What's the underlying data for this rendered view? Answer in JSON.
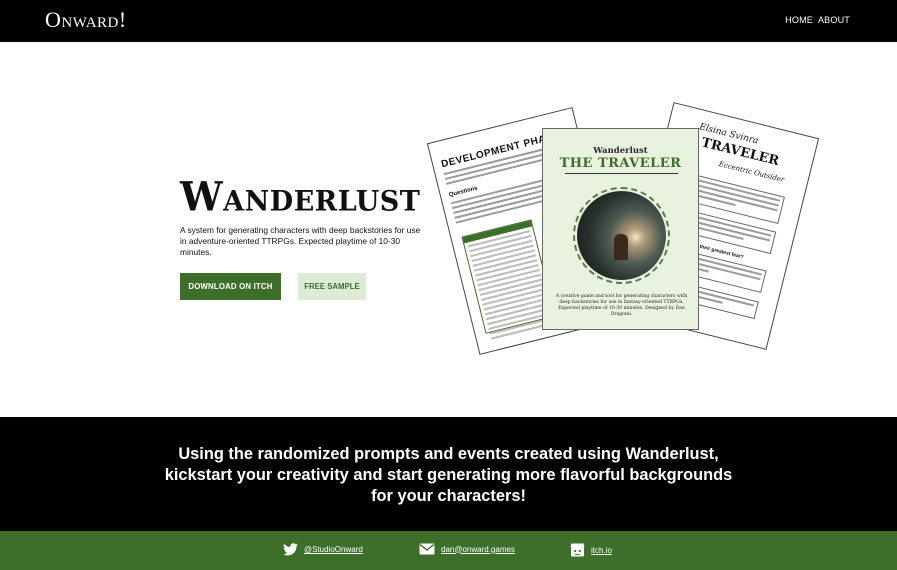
{
  "header": {
    "logo": "Onward!",
    "nav": [
      "HOME",
      "ABOUT"
    ]
  },
  "hero": {
    "title": "Wanderlust",
    "description": "A system for generating characters with deep backstories for use in adventure-oriented TTRPGs. Expected playtime of 10-30 minutes.",
    "download_label": "DOWNLOAD ON ITCH",
    "sample_label": "FREE SAMPLE"
  },
  "pages": {
    "left_heading": "DEVELOPMENT PHA",
    "left_subheading": "Questions",
    "right_name": "Elsina Svinra",
    "right_title": "TRAVELER",
    "right_subtitle": "Eccentric Outsider",
    "right_section": "What is their greatest fear?",
    "center_top": "Wanderlust",
    "center_main": "THE TRAVELER",
    "center_blurb": "A creative game and tool for generating characters with deep backstories for use in fantasy-oriented TTRPGs. Expected playtime of 10-30 minutes. Designed by Dan Dragomi."
  },
  "tagline": "Using the randomized prompts and events created using Wanderlust, kickstart your creativity and start generating more flavorful backgrounds for your characters!",
  "footer": {
    "twitter": "@StudioOnward",
    "email": "dan@onward.games",
    "itch": "itch.io"
  }
}
